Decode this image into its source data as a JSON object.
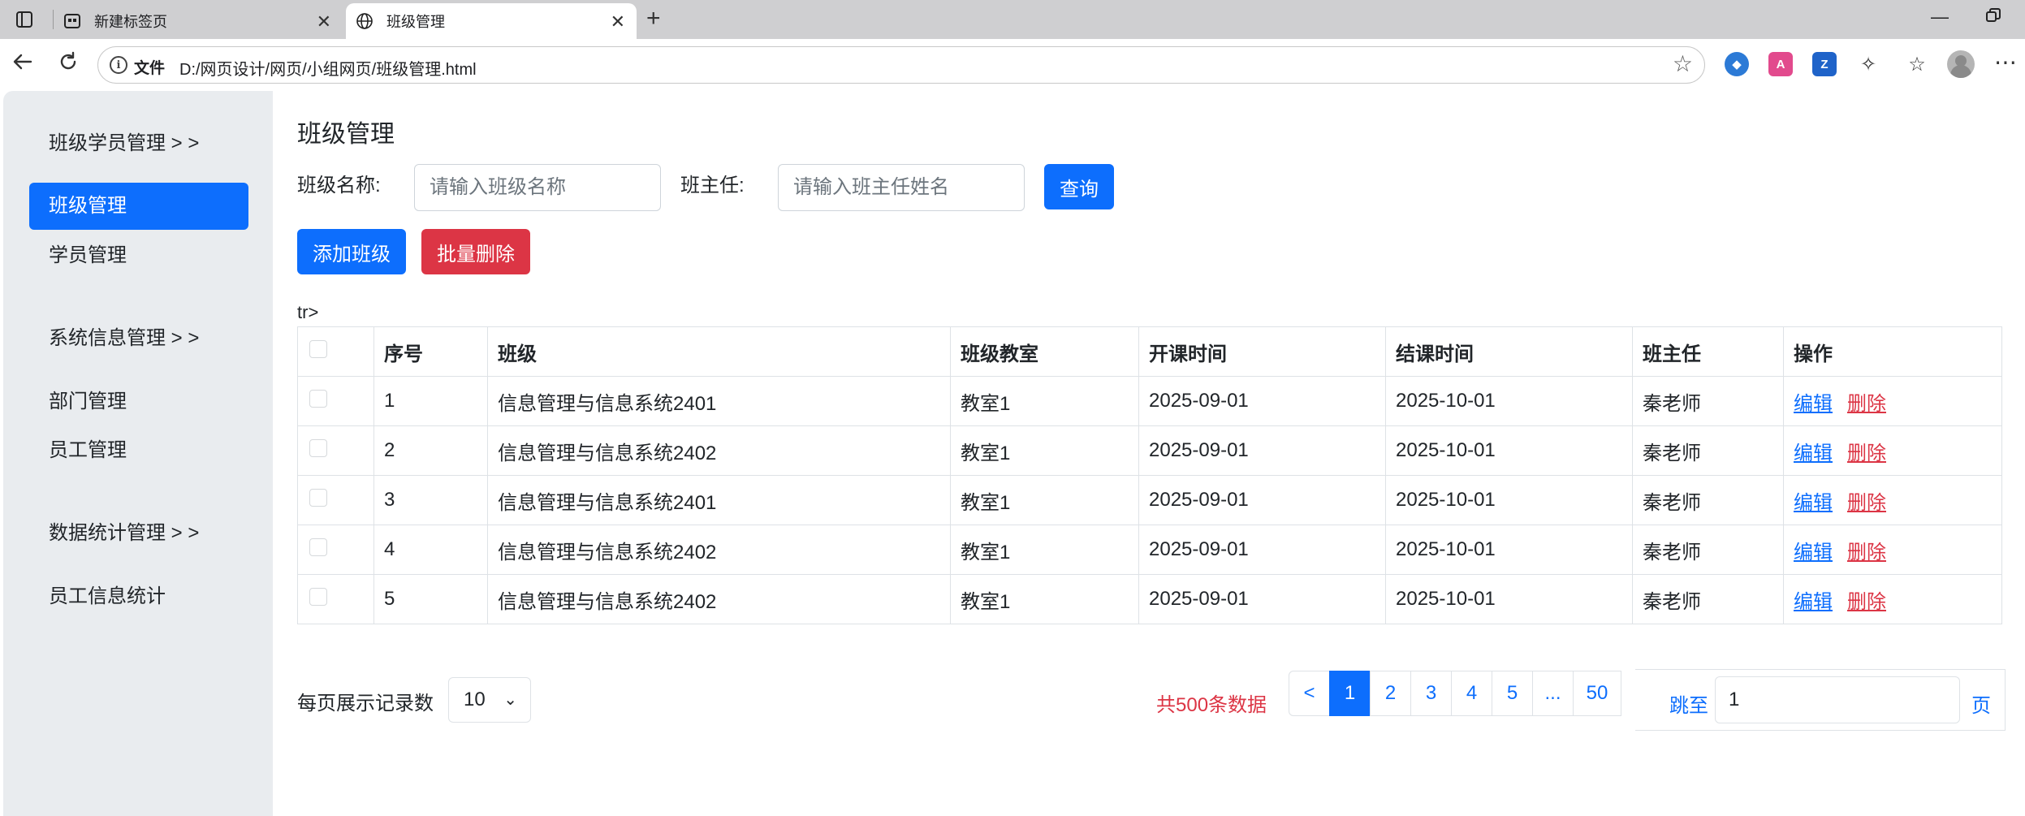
{
  "browser": {
    "tabs": [
      {
        "title": "新建标签页",
        "active": false
      },
      {
        "title": "班级管理",
        "active": true
      }
    ],
    "address": {
      "scheme": "文件",
      "url": "D:/网页设计/网页/小组网页/班级管理.html"
    },
    "extensions": [
      {
        "icon": "shield-extension-icon",
        "color": "#2c7ad6"
      },
      {
        "icon": "translate-extension-icon",
        "color": "#e24a8d"
      },
      {
        "icon": "zotero-extension-icon",
        "color": "#1f63c9"
      }
    ]
  },
  "sidebar": {
    "groups": [
      {
        "title": "班级学员管理 > >",
        "items": [
          "班级管理",
          "学员管理"
        ]
      },
      {
        "title": "系统信息管理 > >",
        "items": [
          "部门管理",
          "员工管理"
        ]
      },
      {
        "title": "数据统计管理 > >",
        "items": [
          "员工信息统计"
        ]
      }
    ],
    "active_item": "班级管理"
  },
  "main": {
    "title": "班级管理",
    "filters": {
      "class_label": "班级名称:",
      "class_placeholder": "请输入班级名称",
      "teacher_label": "班主任:",
      "teacher_placeholder": "请输入班主任姓名",
      "query_button": "查询"
    },
    "actions": {
      "add": "添加班级",
      "batch_delete": "批量删除"
    },
    "stray_text": "tr>",
    "table": {
      "headers": [
        "",
        "序号",
        "班级",
        "班级教室",
        "开课时间",
        "结课时间",
        "班主任",
        "操作"
      ],
      "rows": [
        {
          "no": "1",
          "class": "信息管理与信息系统2401",
          "room": "教室1",
          "start": "2025-09-01",
          "end": "2025-10-01",
          "teacher": "秦老师"
        },
        {
          "no": "2",
          "class": "信息管理与信息系统2402",
          "room": "教室1",
          "start": "2025-09-01",
          "end": "2025-10-01",
          "teacher": "秦老师"
        },
        {
          "no": "3",
          "class": "信息管理与信息系统2401",
          "room": "教室1",
          "start": "2025-09-01",
          "end": "2025-10-01",
          "teacher": "秦老师"
        },
        {
          "no": "4",
          "class": "信息管理与信息系统2402",
          "room": "教室1",
          "start": "2025-09-01",
          "end": "2025-10-01",
          "teacher": "秦老师"
        },
        {
          "no": "5",
          "class": "信息管理与信息系统2402",
          "room": "教室1",
          "start": "2025-09-01",
          "end": "2025-10-01",
          "teacher": "秦老师"
        }
      ],
      "edit_label": "编辑",
      "delete_label": "删除"
    },
    "pagination": {
      "per_page_label": "每页展示记录数",
      "per_page_value": "10",
      "total_text": "共500条数据",
      "pages": [
        "<",
        "1",
        "2",
        "3",
        "4",
        "5",
        "...",
        "50"
      ],
      "active_page": "1",
      "jump_label": "跳至",
      "jump_value": "1",
      "jump_suffix": "页"
    }
  },
  "colors": {
    "primary": "#0d6efd",
    "danger": "#dc3545",
    "sidebar_bg": "#e9ecef"
  }
}
